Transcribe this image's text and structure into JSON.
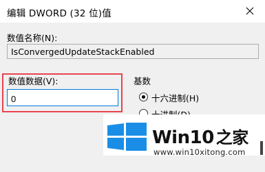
{
  "window": {
    "title": "编辑 DWORD (32 位)值"
  },
  "value_name": {
    "label": "数值名称(N):",
    "value": "IsConvergedUpdateStackEnabled"
  },
  "value_data": {
    "label": "数值数据(V):",
    "value": "0"
  },
  "base": {
    "label": "基数",
    "options": [
      {
        "label": "十六进制(H)",
        "selected": true
      },
      {
        "label": "十进制(D)",
        "selected": false
      }
    ]
  },
  "watermark": {
    "brand_win": "Win10",
    "brand_zhi": "之家",
    "url": "www.win10xitong.com",
    "logo_color": "#1a8ee6"
  },
  "colors": {
    "highlight": "#e8424f",
    "focus_border": "#0078d7"
  }
}
